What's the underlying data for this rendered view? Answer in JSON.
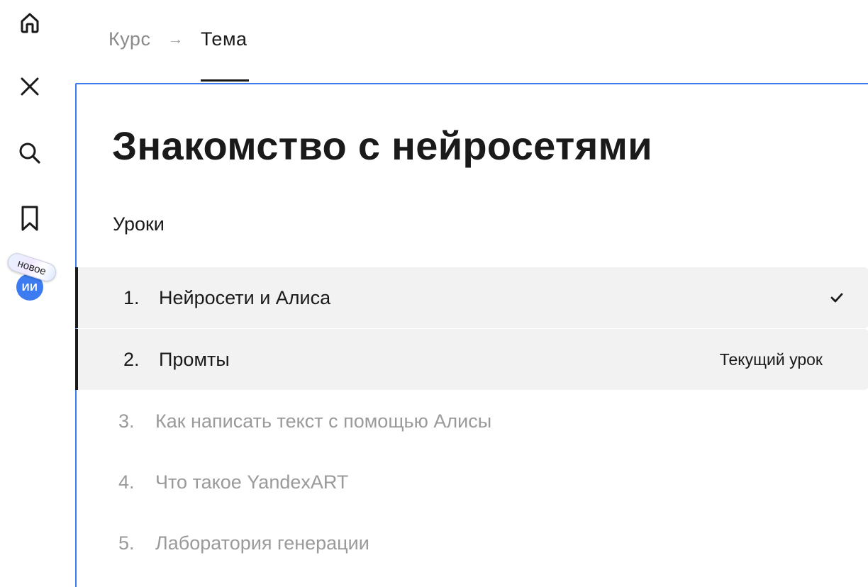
{
  "breadcrumb": {
    "course": "Курс",
    "arrow": "→",
    "topic": "Тема"
  },
  "rail": {
    "icons": [
      "home-icon",
      "close-icon",
      "search-icon",
      "bookmark-icon"
    ],
    "ai": {
      "avatar_text": "ИИ",
      "badge_text": "новое"
    }
  },
  "topic": {
    "title": "Знакомство с нейросетями",
    "lessons_heading": "Уроки",
    "lessons": [
      {
        "number": "1.",
        "title": "Нейросети и Алиса",
        "status": "completed",
        "status_icon": "check-icon"
      },
      {
        "number": "2.",
        "title": "Промты",
        "status_label": "Текущий урок"
      },
      {
        "number": "3.",
        "title": "Как написать текст с помощью Алисы"
      },
      {
        "number": "4.",
        "title": "Что такое YandexART"
      },
      {
        "number": "5.",
        "title": "Лаборатория генерации"
      }
    ]
  },
  "colors": {
    "accent": "#3d7bf0",
    "text": "#1a1a1a",
    "muted_text": "#9a9a9a",
    "active_row_bg": "#f2f2f2"
  }
}
